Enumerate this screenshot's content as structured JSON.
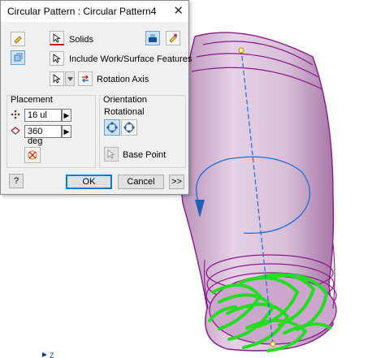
{
  "dialog": {
    "title": "Circular Pattern : Circular Pattern4",
    "close_glyph": "✕",
    "solids_label": "Solids",
    "include_features_label": "Include Work/Surface Features",
    "rotation_axis_label": "Rotation Axis",
    "placement": {
      "heading": "Placement",
      "count_value": "16 ul",
      "angle_value": "360 deg"
    },
    "orientation": {
      "heading": "Orientation",
      "mode_label": "Rotational",
      "base_point_label": "Base Point"
    },
    "buttons": {
      "help": "?",
      "ok": "OK",
      "cancel": "Cancel",
      "more": ">>"
    },
    "field_arrow": "▶",
    "icons": [
      "pattern-features-icon",
      "pattern-solids-icon",
      "select-cursor-icon",
      "flip-direction-icon",
      "fitted-icon",
      "count-icon",
      "angle-icon",
      "rotational-icon",
      "fixed-icon",
      "help-icon"
    ]
  },
  "viewport": {
    "triad_label": "Z",
    "colors": {
      "part_edge": "#8a1a8a",
      "part_fill": "#d6b7d6",
      "axis": "#1e6ed6",
      "preview": "#22dd22",
      "accent": "#0078d7"
    }
  }
}
